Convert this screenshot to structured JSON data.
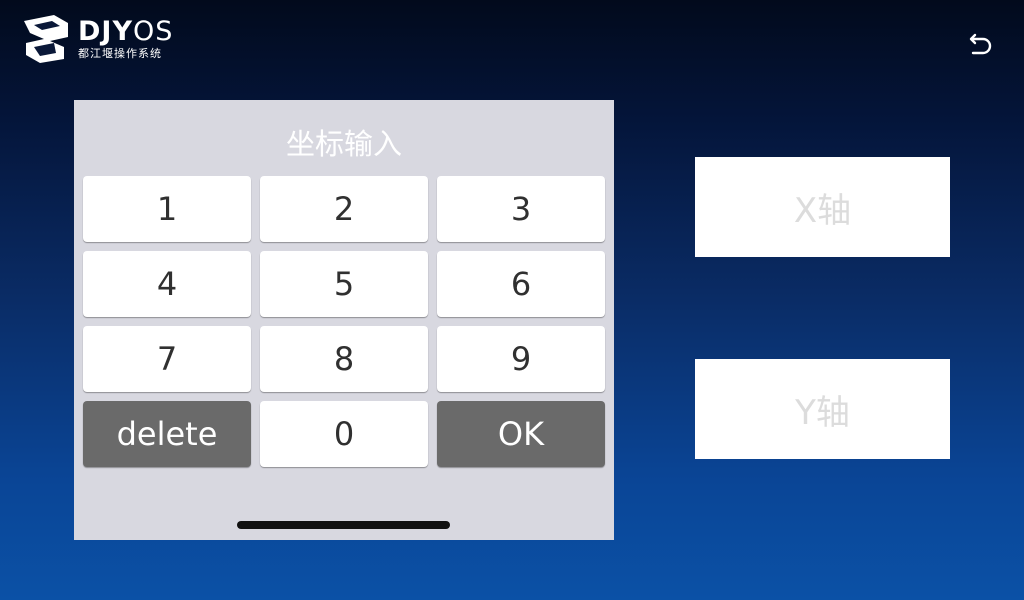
{
  "header": {
    "logo_brand_bold": "DJY",
    "logo_brand_light": "OS",
    "logo_subtitle": "都江堰操作系统",
    "back_icon": "back-arrow-icon"
  },
  "keypad": {
    "title": "坐标输入",
    "keys": [
      "1",
      "2",
      "3",
      "4",
      "5",
      "6",
      "7",
      "8",
      "9",
      "delete",
      "0",
      "OK"
    ]
  },
  "fields": {
    "x_axis": "X轴",
    "y_axis": "Y轴"
  },
  "colors": {
    "panel_bg": "#d8d8e0",
    "key_bg": "#ffffff",
    "key_dark_bg": "#6a6a6a",
    "placeholder_text": "#dcdcdc"
  }
}
